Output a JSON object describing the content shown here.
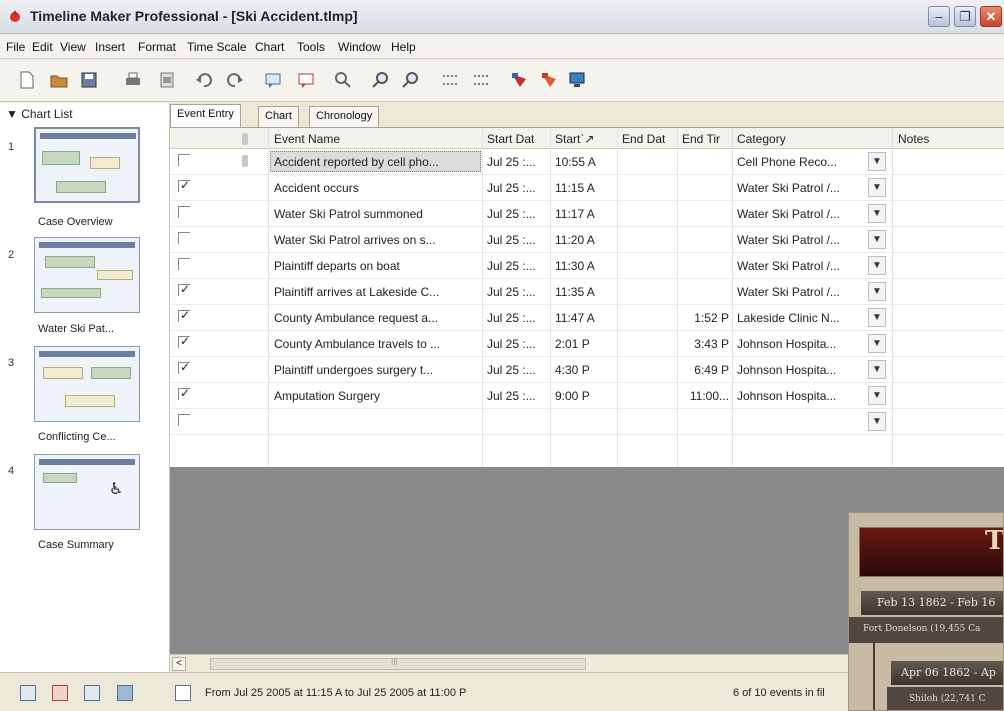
{
  "window": {
    "title": "Timeline Maker Professional - [Ski Accident.tlmp]",
    "minimize": "–",
    "restore": "❐",
    "close": "✕"
  },
  "menu": [
    "File",
    "Edit",
    "View",
    "Insert",
    "Format",
    "Time Scale",
    "Chart",
    "Tools",
    "Window",
    "Help"
  ],
  "toolbar_icons": [
    "new-file-icon",
    "open-folder-icon",
    "save-icon",
    "print-icon",
    "print-preview-icon",
    "undo-icon",
    "redo-icon",
    "comment-icon",
    "comment-red-icon",
    "find-icon",
    "zoom-in-icon",
    "zoom-out-icon",
    "collapse-icon",
    "expand-icon",
    "pin-red-icon",
    "pin-orange-icon",
    "monitor-icon"
  ],
  "chart_list": {
    "header": "▼ Chart List",
    "items": [
      {
        "num": "1",
        "label": "Case Overview"
      },
      {
        "num": "2",
        "label": "Water Ski Pat..."
      },
      {
        "num": "3",
        "label": "Conflicting Ce..."
      },
      {
        "num": "4",
        "label": "Case Summary"
      }
    ]
  },
  "tabs": [
    "Event Entry",
    "Chart",
    "Chronology"
  ],
  "grid": {
    "headers": {
      "event_name": "Event Name",
      "start_date": "Start Dat",
      "start_time": "Start`↗",
      "end_date": "End Dat",
      "end_time": "End Tir",
      "category": "Category",
      "notes": "Notes"
    },
    "rows": [
      {
        "checked": false,
        "attach": true,
        "name": "Accident reported by cell pho...",
        "start_date": "Jul 25 :...",
        "start_time": "10:55 A",
        "end_time": "",
        "category": "Cell Phone Reco..."
      },
      {
        "checked": true,
        "attach": false,
        "name": "Accident occurs",
        "start_date": "Jul 25 :...",
        "start_time": "11:15 A",
        "end_time": "",
        "category": "Water Ski Patrol /..."
      },
      {
        "checked": false,
        "attach": false,
        "name": "Water Ski Patrol summoned",
        "start_date": "Jul 25 :...",
        "start_time": "11:17 A",
        "end_time": "",
        "category": "Water Ski Patrol /..."
      },
      {
        "checked": false,
        "attach": false,
        "name": "Water Ski Patrol arrives on s...",
        "start_date": "Jul 25 :...",
        "start_time": "11:20 A",
        "end_time": "",
        "category": "Water Ski Patrol /..."
      },
      {
        "checked": false,
        "attach": false,
        "name": "Plaintiff departs on boat",
        "start_date": "Jul 25 :...",
        "start_time": "11:30 A",
        "end_time": "",
        "category": "Water Ski Patrol /..."
      },
      {
        "checked": true,
        "attach": false,
        "name": "Plaintiff arrives at Lakeside C...",
        "start_date": "Jul 25 :...",
        "start_time": "11:35 A",
        "end_time": "",
        "category": "Water Ski Patrol /..."
      },
      {
        "checked": true,
        "attach": false,
        "name": "County Ambulance request a...",
        "start_date": "Jul 25 :...",
        "start_time": "11:47 A",
        "end_time": "1:52 P",
        "category": "Lakeside Clinic N..."
      },
      {
        "checked": true,
        "attach": false,
        "name": "County Ambulance travels to ...",
        "start_date": "Jul 25 :...",
        "start_time": "2:01 P",
        "end_time": "3:43 P",
        "category": "Johnson Hospita..."
      },
      {
        "checked": true,
        "attach": false,
        "name": "Plaintiff undergoes surgery t...",
        "start_date": "Jul 25 :...",
        "start_time": "4:30 P",
        "end_time": "6:49 P",
        "category": "Johnson Hospita..."
      },
      {
        "checked": true,
        "attach": false,
        "name": "Amputation Surgery",
        "start_date": "Jul 25 :...",
        "start_time": "9:00 P",
        "end_time": "11:00...",
        "category": "Johnson Hospita..."
      },
      {
        "checked": false,
        "attach": false,
        "name": "",
        "start_date": "",
        "start_time": "",
        "end_time": "",
        "category": ""
      }
    ]
  },
  "scrollbar": {
    "left_arrow": "<",
    "thumb_grip": "III"
  },
  "status": {
    "range_text": "From Jul 25 2005 at 11:15 A to Jul 25 2005 at 11:00 P",
    "count_text": "6 of 10 events in fil"
  },
  "overlay": {
    "banner_letter": "T",
    "date1": "Feb 13 1862 - Feb 16",
    "sub1": "Fort Donelson (19,455 Ca",
    "date2": "Apr 06 1862 - Ap",
    "sub2": "Shiloh (22,741 C"
  },
  "colors": {
    "accent": "#6c7fa3",
    "selection": "#dcdcdc",
    "empty_area": "#8a8a8a"
  }
}
